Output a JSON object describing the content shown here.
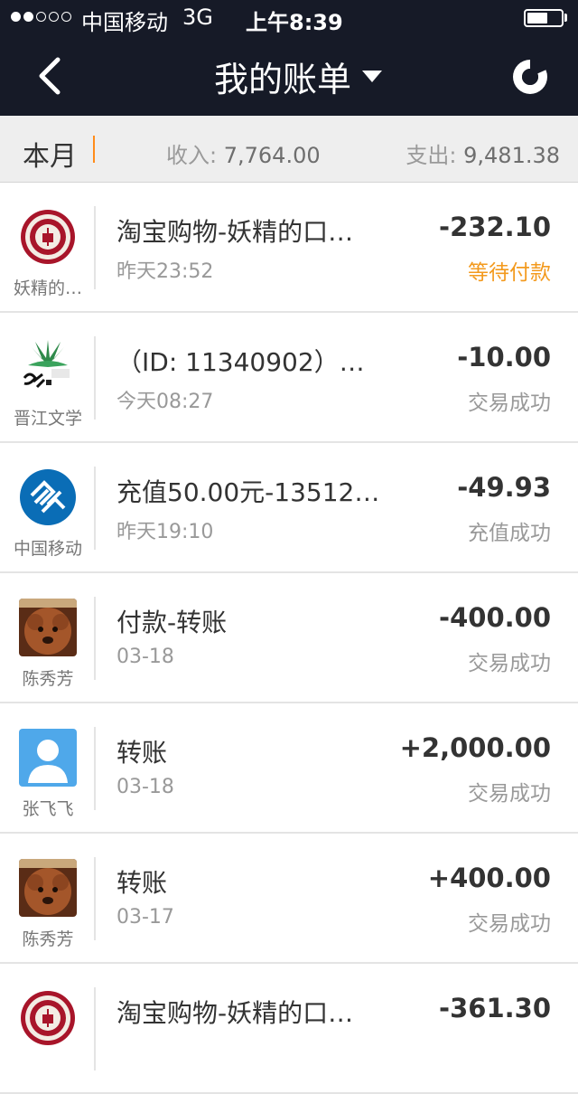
{
  "status_bar": {
    "carrier": "中国移动",
    "network": "3G",
    "time": "上午8:39"
  },
  "nav": {
    "title": "我的账单",
    "back_icon": "chevron-left-icon",
    "stats_icon": "pie-chart-icon"
  },
  "summary": {
    "period": "本月",
    "income_label": "收入:",
    "income_value": "7,764.00",
    "expense_label": "支出:",
    "expense_value": "9,481.38"
  },
  "colors": {
    "header_bg": "#161a27",
    "accent_orange": "#f39a1e",
    "text_dark": "#333333",
    "text_gray": "#999999"
  },
  "bills": [
    {
      "avatar": "seal-badge-avatar",
      "name": "妖精的…",
      "title": "淘宝购物-妖精的口…",
      "time": "昨天23:52",
      "amount": "-232.10",
      "status": "等待付款",
      "pending": true
    },
    {
      "avatar": "jinjiang-literature-avatar",
      "name": "晋江文学",
      "title": "（ID: 11340902）…",
      "time": "今天08:27",
      "amount": "-10.00",
      "status": "交易成功",
      "pending": false
    },
    {
      "avatar": "china-mobile-logo",
      "name": "中国移动",
      "title": "充值50.00元-13512…",
      "time": "昨天19:10",
      "amount": "-49.93",
      "status": "充值成功",
      "pending": false
    },
    {
      "avatar": "dog-photo-avatar",
      "name": "陈秀芳",
      "title": "付款-转账",
      "time": "03-18",
      "amount": "-400.00",
      "status": "交易成功",
      "pending": false
    },
    {
      "avatar": "default-person-avatar",
      "name": "张飞飞",
      "title": "转账",
      "time": "03-18",
      "amount": "+2,000.00",
      "status": "交易成功",
      "pending": false
    },
    {
      "avatar": "dog-photo-avatar",
      "name": "陈秀芳",
      "title": "转账",
      "time": "03-17",
      "amount": "+400.00",
      "status": "交易成功",
      "pending": false
    },
    {
      "avatar": "seal-badge-avatar",
      "name": "",
      "title": "淘宝购物-妖精的口…",
      "time": "",
      "amount": "-361.30",
      "status": "",
      "pending": false
    }
  ]
}
